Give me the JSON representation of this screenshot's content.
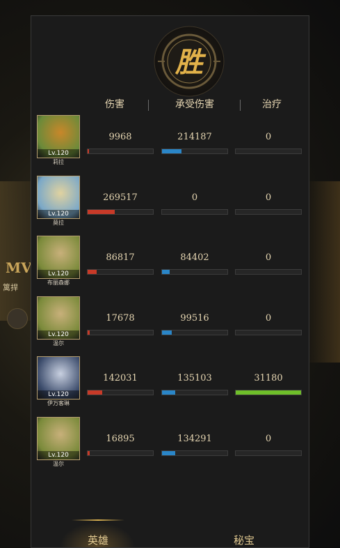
{
  "background": {
    "mvp_text": "MV",
    "sub_text": "篱捍"
  },
  "header": {
    "victory_glyph": "胜",
    "col_damage": "伤害",
    "col_taken": "承受伤害",
    "col_heal": "治疗"
  },
  "heroes": [
    {
      "level": "Lv.120",
      "name": "莉拉",
      "damage": "9968",
      "taken": "214187",
      "heal": "0",
      "damage_frac": 0.02,
      "taken_frac": 0.3,
      "heal_frac": 0
    },
    {
      "level": "Lv.120",
      "name": "莫拉",
      "damage": "269517",
      "taken": "0",
      "heal": "0",
      "damage_frac": 0.42,
      "taken_frac": 0,
      "heal_frac": 0
    },
    {
      "level": "Lv.120",
      "name": "布丽森娜",
      "damage": "86817",
      "taken": "84402",
      "heal": "0",
      "damage_frac": 0.14,
      "taken_frac": 0.12,
      "heal_frac": 0
    },
    {
      "level": "Lv.120",
      "name": "温尔",
      "damage": "17678",
      "taken": "99516",
      "heal": "0",
      "damage_frac": 0.03,
      "taken_frac": 0.15,
      "heal_frac": 0
    },
    {
      "level": "Lv.120",
      "name": "伊万客琳",
      "damage": "142031",
      "taken": "135103",
      "heal": "31180",
      "damage_frac": 0.22,
      "taken_frac": 0.2,
      "heal_frac": 1.0
    },
    {
      "level": "Lv.120",
      "name": "温尔",
      "damage": "16895",
      "taken": "134291",
      "heal": "0",
      "damage_frac": 0.03,
      "taken_frac": 0.2,
      "heal_frac": 0
    }
  ],
  "tabs": {
    "heroes": "英雄",
    "treasure": "秘宝"
  },
  "colors": {
    "damage": "#c83a28",
    "taken": "#2a86c8",
    "heal": "#6fbf2a",
    "gold": "#d8b050"
  }
}
